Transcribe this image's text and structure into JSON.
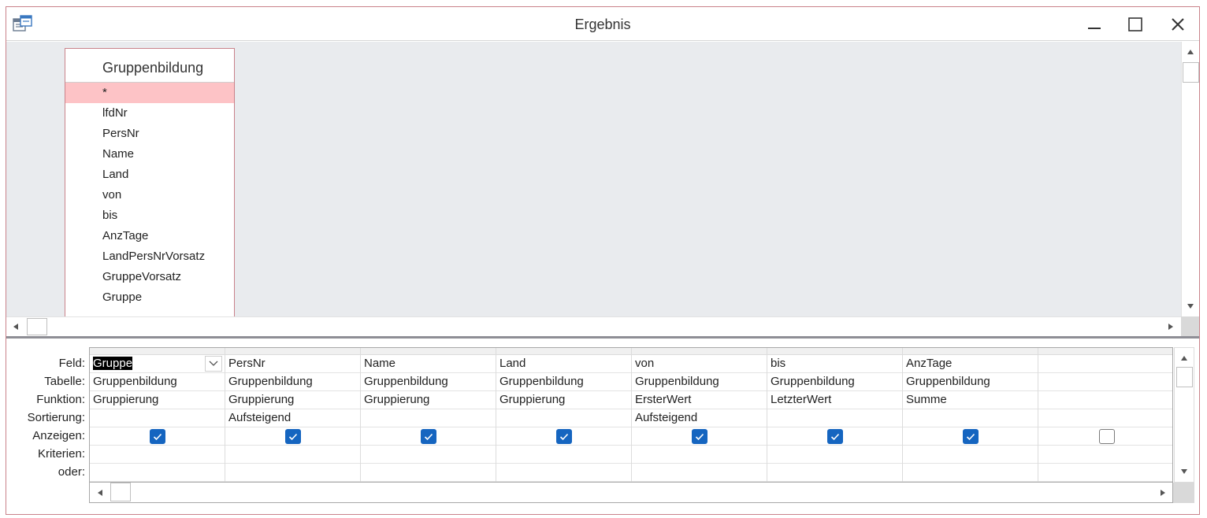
{
  "window": {
    "title": "Ergebnis",
    "controls": {
      "minimize": "minimize-icon",
      "maximize": "maximize-icon",
      "close": "close-icon"
    }
  },
  "table": {
    "name": "Gruppenbildung",
    "fields": [
      "*",
      "lfdNr",
      "PersNr",
      "Name",
      "Land",
      "von",
      "bis",
      "AnzTage",
      "LandPersNrVorsatz",
      "GruppeVorsatz",
      "Gruppe"
    ]
  },
  "grid": {
    "row_labels": [
      "Feld:",
      "Tabelle:",
      "Funktion:",
      "Sortierung:",
      "Anzeigen:",
      "Kriterien:",
      "oder:"
    ],
    "columns": [
      {
        "feld": "Gruppe",
        "tabelle": "Gruppenbildung",
        "funktion": "Gruppierung",
        "sortierung": "",
        "anzeigen": true
      },
      {
        "feld": "PersNr",
        "tabelle": "Gruppenbildung",
        "funktion": "Gruppierung",
        "sortierung": "Aufsteigend",
        "anzeigen": true
      },
      {
        "feld": "Name",
        "tabelle": "Gruppenbildung",
        "funktion": "Gruppierung",
        "sortierung": "",
        "anzeigen": true
      },
      {
        "feld": "Land",
        "tabelle": "Gruppenbildung",
        "funktion": "Gruppierung",
        "sortierung": "",
        "anzeigen": true
      },
      {
        "feld": "von",
        "tabelle": "Gruppenbildung",
        "funktion": "ErsterWert",
        "sortierung": "Aufsteigend",
        "anzeigen": true
      },
      {
        "feld": "bis",
        "tabelle": "Gruppenbildung",
        "funktion": "LetzterWert",
        "sortierung": "",
        "anzeigen": true
      },
      {
        "feld": "AnzTage",
        "tabelle": "Gruppenbildung",
        "funktion": "Summe",
        "sortierung": "",
        "anzeigen": true
      },
      {
        "feld": "",
        "tabelle": "",
        "funktion": "",
        "sortierung": "",
        "anzeigen": false
      }
    ]
  },
  "colors": {
    "accent_check": "#1565c0",
    "window_border": "#c9828a",
    "selected_field": "#fdc3c6",
    "pane_bg": "#e9ebee"
  }
}
